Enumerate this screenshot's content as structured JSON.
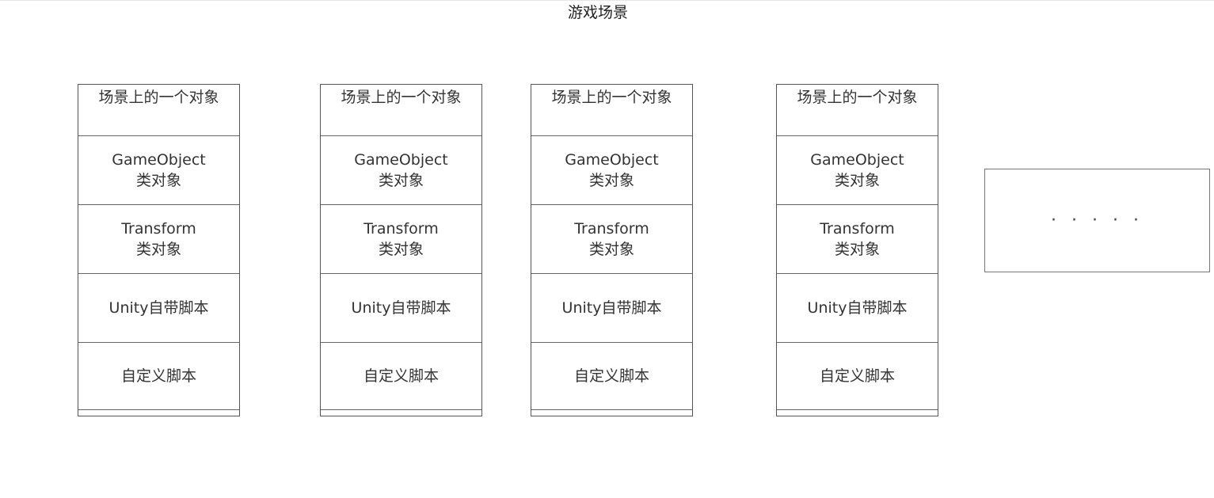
{
  "title": "游戏场景",
  "objects": [
    {
      "header": "场景上的一个对象",
      "gameobject": [
        "GameObject",
        "类对象"
      ],
      "transform": [
        "Transform",
        "类对象"
      ],
      "unity_scripts": "Unity自带脚本",
      "custom_scripts": "自定义脚本"
    },
    {
      "header": "场景上的一个对象",
      "gameobject": [
        "GameObject",
        "类对象"
      ],
      "transform": [
        "Transform",
        "类对象"
      ],
      "unity_scripts": "Unity自带脚本",
      "custom_scripts": "自定义脚本"
    },
    {
      "header": "场景上的一个对象",
      "gameobject": [
        "GameObject",
        "类对象"
      ],
      "transform": [
        "Transform",
        "类对象"
      ],
      "unity_scripts": "Unity自带脚本",
      "custom_scripts": "自定义脚本"
    },
    {
      "header": "场景上的一个对象",
      "gameobject": [
        "GameObject",
        "类对象"
      ],
      "transform": [
        "Transform",
        "类对象"
      ],
      "unity_scripts": "Unity自带脚本",
      "custom_scripts": "自定义脚本"
    }
  ],
  "more": "· · · · ·",
  "colors": {
    "border": "#555555",
    "text": "#333333",
    "background": "#ffffff"
  }
}
